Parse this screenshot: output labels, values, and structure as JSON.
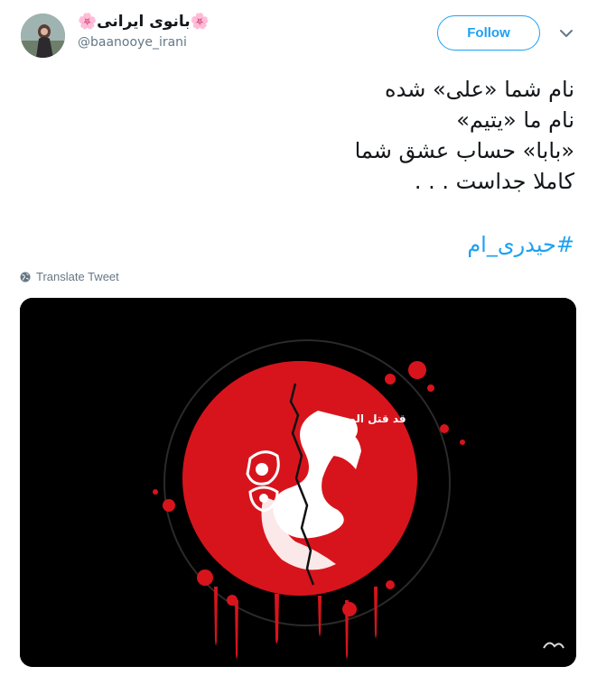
{
  "author": {
    "display_name": "بانوی ایرانی",
    "flower_emoji": "🌸",
    "handle": "@baanooye_irani"
  },
  "header": {
    "follow_label": "Follow",
    "caret_icon": "chevron-down-icon"
  },
  "tweet": {
    "lines": [
      "نام شما «علی» شده",
      "نام ما «یتیم»",
      "«بابا» حساب عشق شما",
      "کاملا جداست . . ."
    ],
    "hashtag": "#حیدری_ام"
  },
  "translate": {
    "label": "Translate Tweet",
    "icon": "globe-icon"
  },
  "media": {
    "image_text": "قد قتل المرتضی",
    "colors": {
      "circle": "#d7141c",
      "background": "#000000",
      "ink": "#ffffff"
    }
  },
  "colors": {
    "accent": "#1da1f2",
    "text": "#14171a",
    "secondary": "#657786"
  }
}
